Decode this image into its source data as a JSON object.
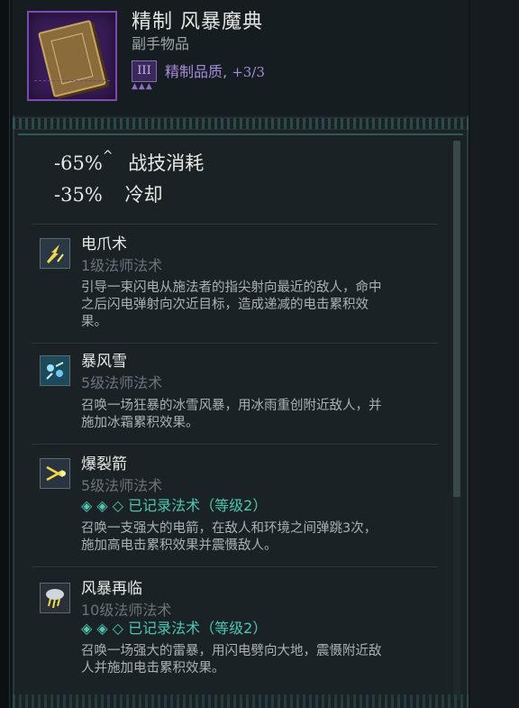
{
  "item": {
    "title": "精制 风暴魔典",
    "type": "副手物品",
    "quality_badge": "III",
    "quality_dots": "▲▲▲",
    "quality_label": "精制品质, ",
    "quality_value": "+3/3",
    "icon": "spellbook-icon"
  },
  "stats": [
    {
      "value": "-65%",
      "caret": "^",
      "label": "战技消耗"
    },
    {
      "value": "-35%",
      "caret": "",
      "label": "冷却"
    }
  ],
  "skills": [
    {
      "name": "电爪术",
      "level": "1级法师法术",
      "desc_lines": [
        "引导一束闪电从施法者的指尖射向最近的敌人，命中",
        "之后闪电弹射向次近目标，造成递减的电击累积效",
        "果。"
      ],
      "recorded": "",
      "icon": "lightning-claw-icon"
    },
    {
      "name": "暴风雪",
      "level": "5级法师法术",
      "desc_lines": [
        "召唤一场狂暴的冰雪风暴，用冰雨重创附近敌人，并",
        "施加冰霜累积效果。"
      ],
      "recorded": "",
      "icon": "blizzard-icon"
    },
    {
      "name": "爆裂箭",
      "level": "5级法师法术",
      "desc_lines": [
        "召唤一支强大的电箭，在敌人和环境之间弹跳3次，",
        "施加高电击累积效果并震慑敌人。"
      ],
      "recorded": "◈ ◈ ◇  已记录法术（等级2）",
      "icon": "shock-arrow-icon"
    },
    {
      "name": "风暴再临",
      "level": "10级法师法术",
      "desc_lines": [
        "召唤一场强大的雷暴，用闪电劈向大地，震慑附近敌",
        "人并施加电击累积效果。"
      ],
      "recorded": "◈ ◈ ◇  已记录法术（等级2）",
      "icon": "storm-cloud-icon"
    }
  ],
  "colors": {
    "background": "#1a2226",
    "quality": "#a88adc",
    "recorded": "#4ec6b0"
  }
}
